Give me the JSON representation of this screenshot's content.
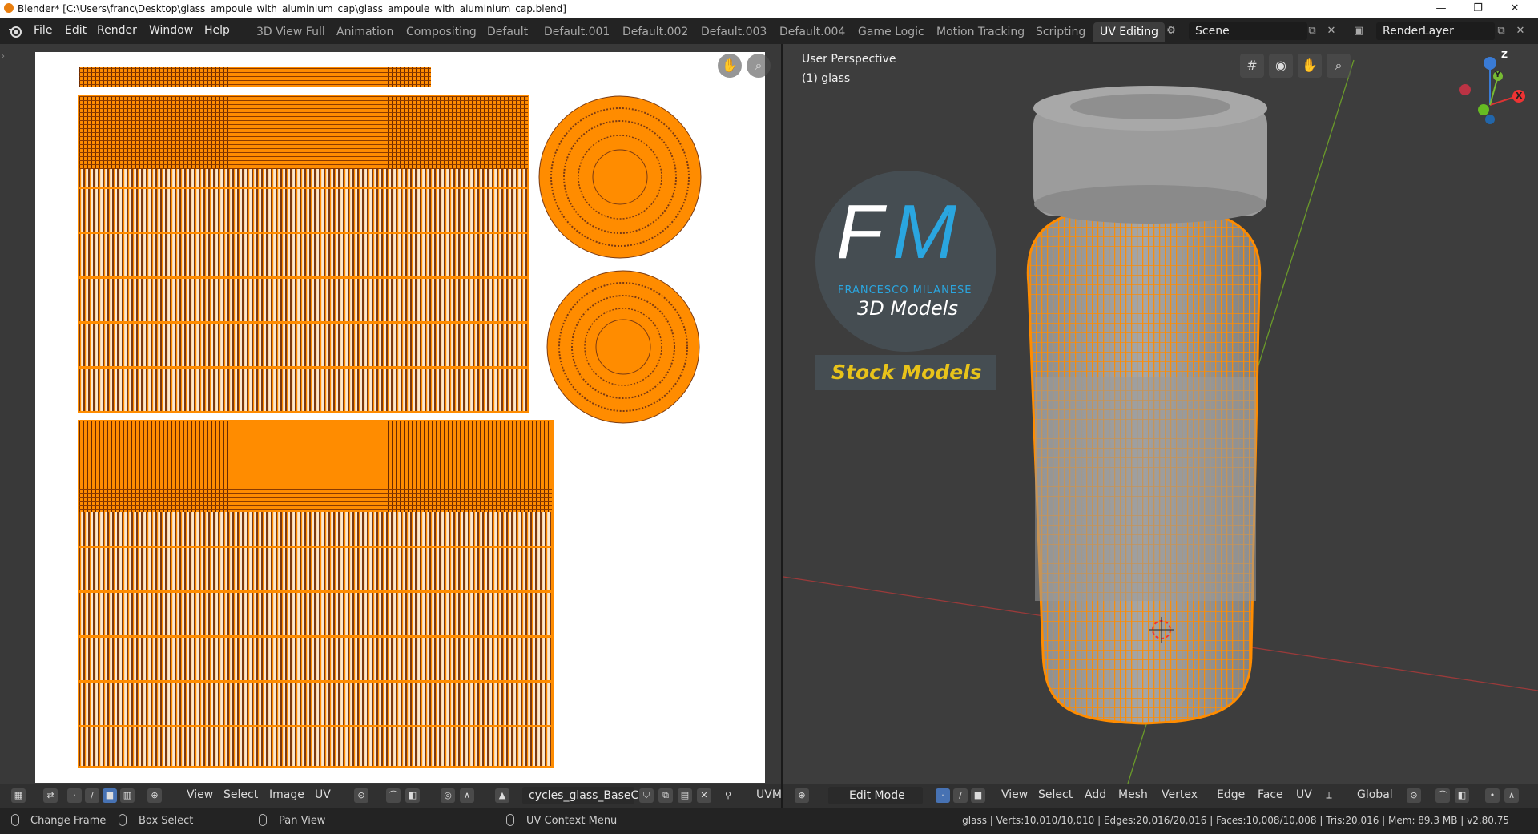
{
  "window": {
    "title": "Blender* [C:\\Users\\franc\\Desktop\\glass_ampoule_with_aluminium_cap\\glass_ampoule_with_aluminium_cap.blend]",
    "minimize": "—",
    "restore": "❐",
    "close": "✕"
  },
  "menu": {
    "file": "File",
    "edit": "Edit",
    "render": "Render",
    "window": "Window",
    "help": "Help"
  },
  "workspaces": [
    "3D View Full",
    "Animation",
    "Compositing",
    "Default",
    "Default.001",
    "Default.002",
    "Default.003",
    "Default.004",
    "Game Logic",
    "Motion Tracking",
    "Scripting",
    "UV Editing"
  ],
  "active_workspace": "UV Editing",
  "scene": {
    "label": "Scene"
  },
  "renderlayer": {
    "label": "RenderLayer"
  },
  "viewport": {
    "perspective": "User Perspective",
    "object": "(1) glass",
    "axes": {
      "x": "X",
      "y": "Y",
      "z": "Z"
    }
  },
  "watermark": {
    "initials_f": "F",
    "initials_m": "M",
    "name": "FRANCESCO MILANESE",
    "subtitle": "3D Models",
    "stock": "Stock Models"
  },
  "image_editor_header": {
    "view": "View",
    "select": "Select",
    "image": "Image",
    "uv": "UV",
    "image_name": "cycles_glass_BaseC...",
    "uvmap": "UVM"
  },
  "viewport_header": {
    "mode": "Edit Mode",
    "view": "View",
    "select": "Select",
    "add": "Add",
    "mesh": "Mesh",
    "vertex": "Vertex",
    "edge": "Edge",
    "face": "Face",
    "uv": "UV",
    "orientation": "Global"
  },
  "statusbar": {
    "change_frame": "Change Frame",
    "box_select": "Box Select",
    "pan_view": "Pan View",
    "uv_context": "UV Context Menu",
    "stats": "glass | Verts:10,010/10,010 | Edges:20,016/20,016 | Faces:10,008/10,008 | Tris:20,016 | Mem: 89.3 MB | v2.80.75"
  },
  "colors": {
    "accent": "#4772b3",
    "uv_orange": "#ff8c00",
    "uv_edge": "#6b2a00",
    "watermark_blue": "#2aa6e0",
    "watermark_yellow": "#e8c31a"
  }
}
